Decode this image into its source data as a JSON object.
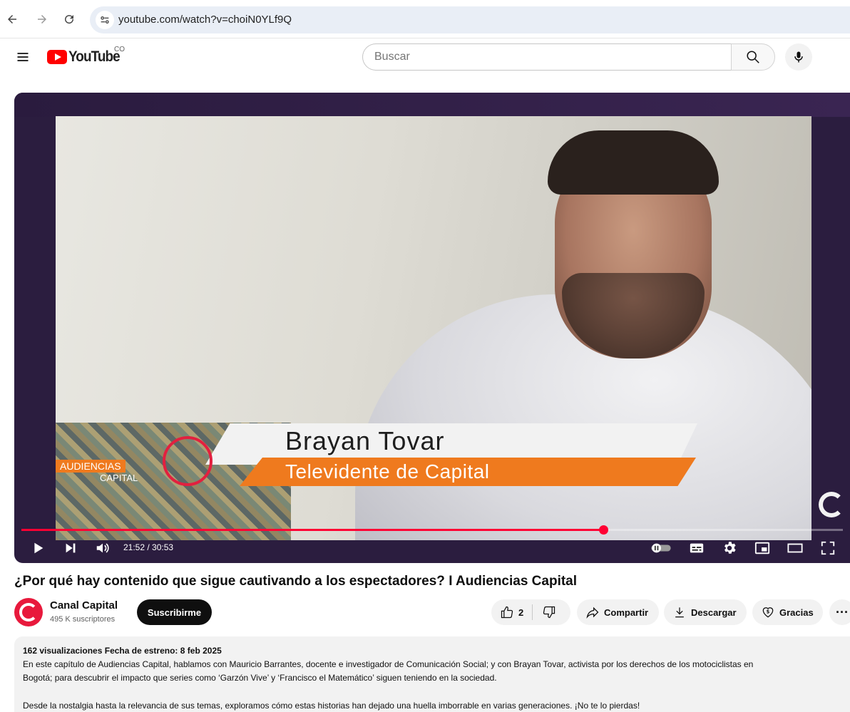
{
  "browser": {
    "url": "youtube.com/watch?v=choiN0YLf9Q"
  },
  "header": {
    "logo_text": "YouTube",
    "country_code": "CO",
    "search_placeholder": "Buscar"
  },
  "player": {
    "lower_third_name": "Brayan Tovar",
    "lower_third_role": "Televidente de Capital",
    "show_logo_line1": "AUDIENCIAS",
    "show_logo_line2": "CAPITAL",
    "time_display": "21:52 / 30:53",
    "progress": 0.708
  },
  "video": {
    "title": "¿Por qué hay contenido que sigue cautivando a los espectadores? I Audiencias Capital"
  },
  "channel": {
    "name": "Canal Capital",
    "subscribers": "495 K suscriptores",
    "subscribe_label": "Suscribirme"
  },
  "actions": {
    "likes": "2",
    "share_label": "Compartir",
    "download_label": "Descargar",
    "thanks_label": "Gracias",
    "more_label": "···"
  },
  "description": {
    "meta": "162 visualizaciones  Fecha de estreno: 8 feb 2025",
    "line1": "En este capítulo de Audiencias Capital, hablamos con Mauricio Barrantes, docente e investigador de Comunicación Social; y con Brayan Tovar, activista por los derechos de los motociclistas en",
    "line2": "Bogotá; para descubrir el impacto que series como ‘Garzón Vive’ y ‘Francisco el Matemático’ siguen teniendo en la sociedad.",
    "line3": "Desde la nostalgia hasta la relevancia de sus temas, exploramos cómo estas historias han dejado una huella imborrable en varias generaciones. ¡No te lo pierdas!"
  },
  "colors": {
    "accent_red": "#ff0033",
    "brand_red": "#ff0000",
    "lower_third_orange": "#ef7a1e",
    "player_frame": "#2b1d3f"
  }
}
